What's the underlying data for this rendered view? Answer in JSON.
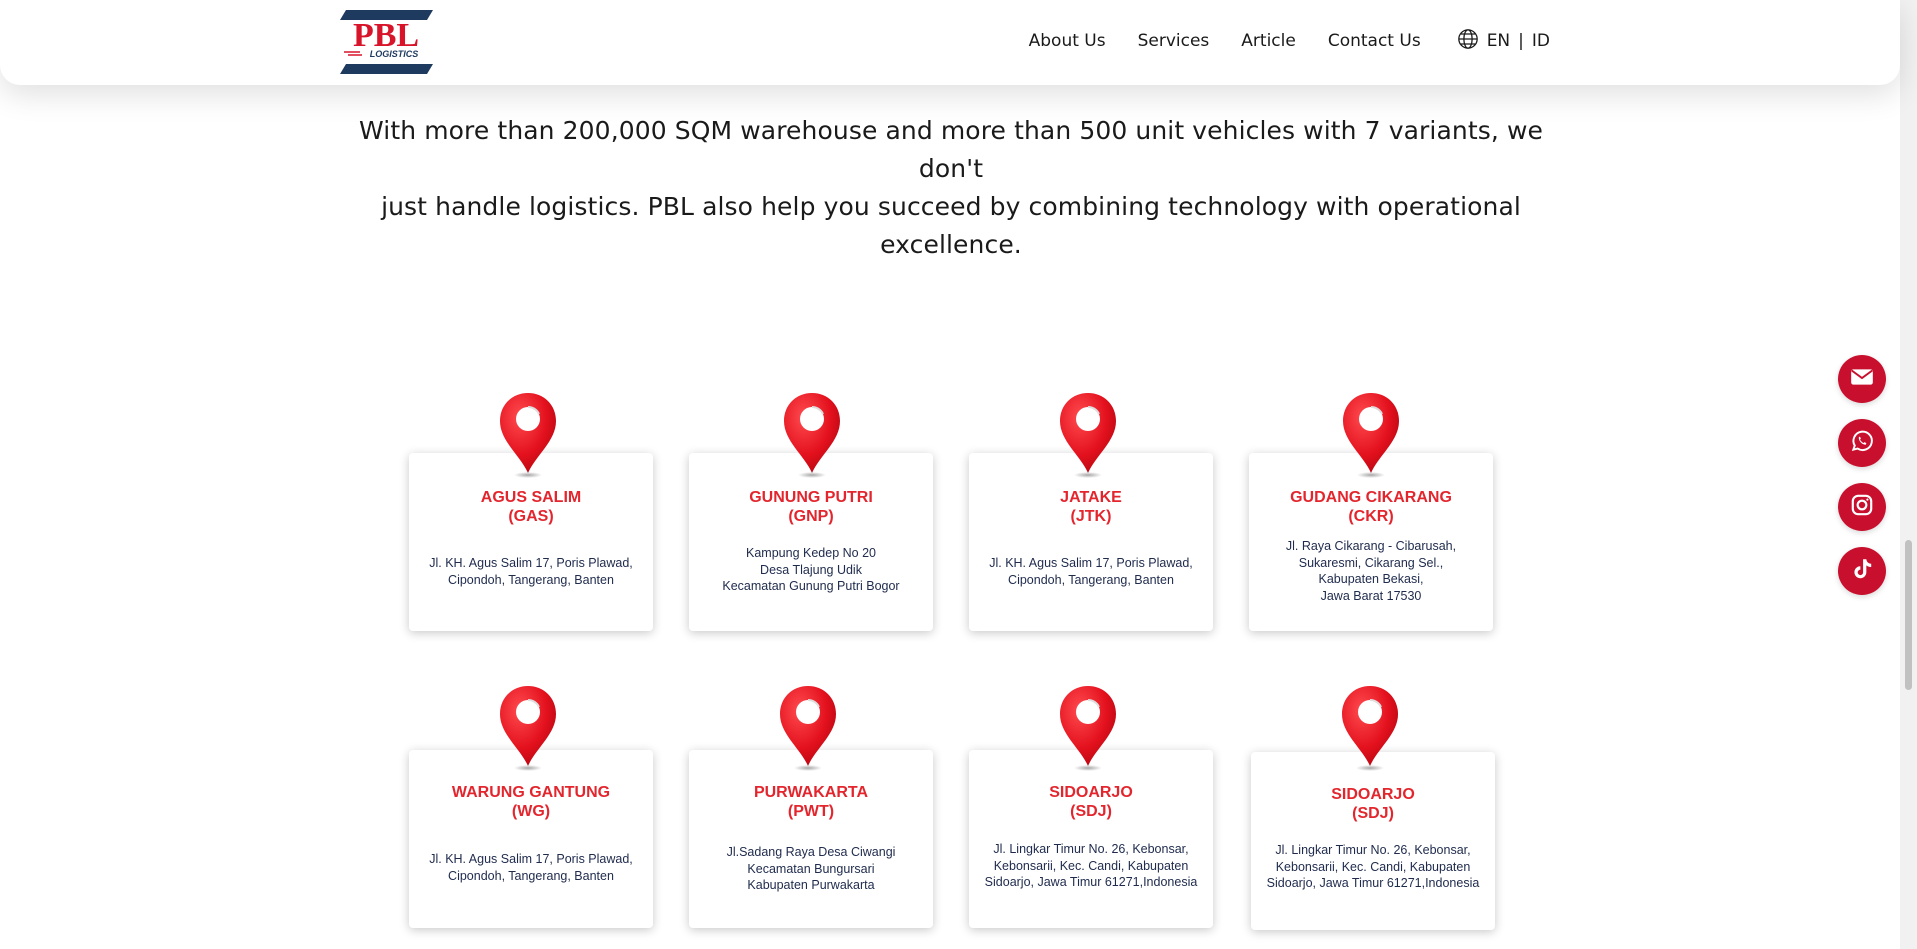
{
  "header": {
    "logo": {
      "brand": "PBL",
      "sub": "LOGISTICS"
    },
    "nav": [
      "About Us",
      "Services",
      "Article",
      "Contact Us"
    ],
    "lang": {
      "en": "EN",
      "sep": "|",
      "id": "ID",
      "icon": "globe-icon"
    }
  },
  "intro": {
    "line1": "With more than 200,000 SQM warehouse and more than 500 unit vehicles with 7 variants, we don't",
    "line2": "just handle logistics. PBL also help you succeed by combining technology with operational",
    "line3": "excellence."
  },
  "locations": [
    {
      "name": "AGUS SALIM",
      "code": "(GAS)",
      "address": [
        "Jl. KH. Agus Salim 17, Poris Plawad,",
        "Cipondoh, Tangerang, Banten"
      ]
    },
    {
      "name": "GUNUNG PUTRI",
      "code": "(GNP)",
      "address": [
        "Kampung Kedep No 20",
        "Desa Tlajung Udik",
        "Kecamatan Gunung Putri Bogor"
      ]
    },
    {
      "name": "JATAKE",
      "code": "(JTK)",
      "address": [
        "Jl. KH. Agus Salim 17, Poris Plawad,",
        "Cipondoh, Tangerang, Banten"
      ]
    },
    {
      "name": "GUDANG CIKARANG",
      "code": "(CKR)",
      "address": [
        "Jl. Raya Cikarang - Cibarusah,",
        "Sukaresmi, Cikarang Sel.,",
        "Kabupaten Bekasi,",
        "Jawa Barat 17530"
      ]
    },
    {
      "name": "WARUNG GANTUNG",
      "code": "(WG)",
      "address": [
        "Jl. KH. Agus Salim 17, Poris Plawad,",
        "Cipondoh, Tangerang, Banten"
      ]
    },
    {
      "name": "PURWAKARTA",
      "code": "(PWT)",
      "address": [
        "Jl.Sadang Raya Desa Ciwangi",
        "Kecamatan Bungursari",
        "Kabupaten Purwakarta"
      ]
    },
    {
      "name": "SIDOARJO",
      "code": "(SDJ)",
      "address": [
        "Jl. Lingkar Timur No. 26, Kebonsar,",
        "Kebonsarii, Kec. Candi, Kabupaten",
        "Sidoarjo, Jawa Timur 61271,Indonesia"
      ]
    },
    {
      "name": "SIDOARJO",
      "code": "(SDJ)",
      "address": [
        "Jl. Lingkar Timur No. 26, Kebonsar,",
        "Kebonsarii, Kec. Candi, Kabupaten",
        "Sidoarjo, Jawa Timur 61271,Indonesia"
      ]
    }
  ],
  "floating_buttons": [
    "email-icon",
    "whatsapp-icon",
    "instagram-icon",
    "tiktok-icon"
  ],
  "colors": {
    "accent": "#e3262e",
    "button": "#c8102e",
    "brand_navy": "#1e3a5f"
  }
}
